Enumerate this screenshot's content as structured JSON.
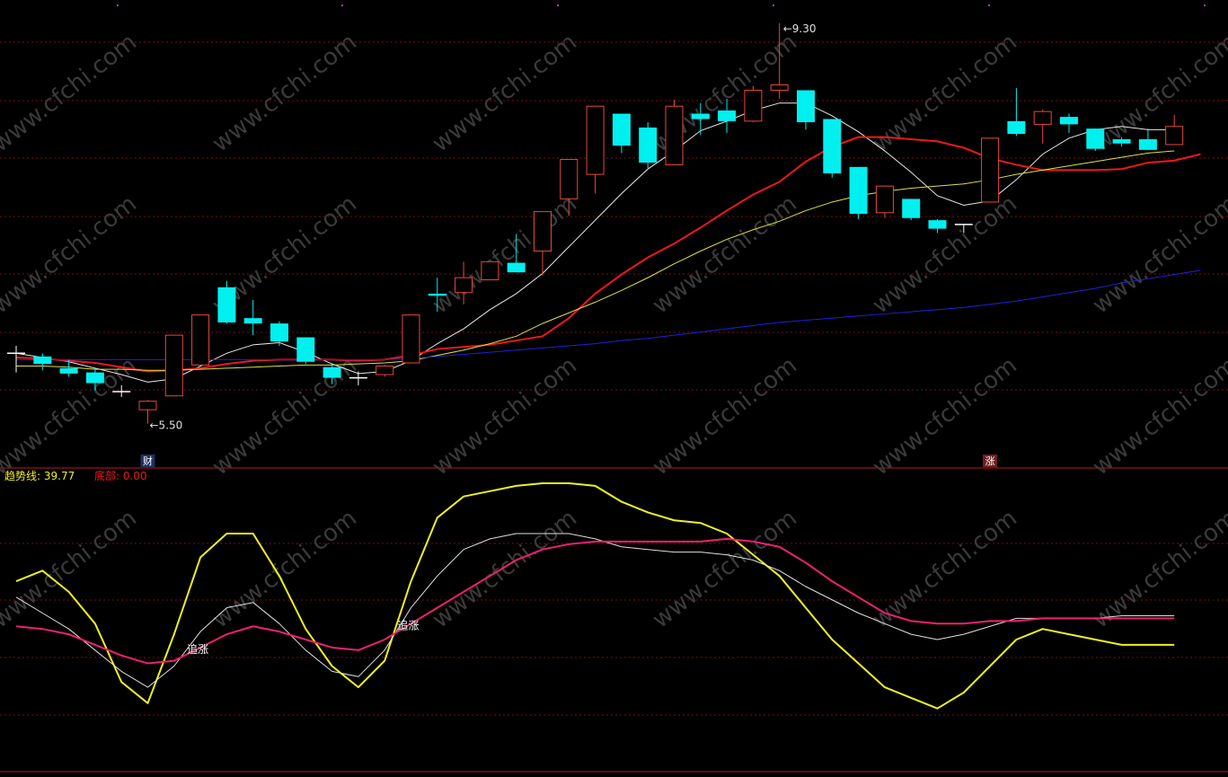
{
  "colors": {
    "background": "#000000",
    "up": "#e8483a",
    "down": "#00f0f0",
    "grid": "#7a1010",
    "separator": "#c01818",
    "ma_white": "#e8e8e8",
    "ma_red": "#f01818",
    "ma_yellow": "#e0e040",
    "ma_blue": "#2020e0",
    "ind_yellow": "#f0f020",
    "ind_white": "#e0e0e0",
    "ind_pink": "#f02070",
    "watermark": "#3a3a3a"
  },
  "watermark_text": "www.cfchi.com",
  "chart_data": [
    {
      "type": "candlestick",
      "ylim": [
        5.3,
        9.45
      ],
      "grid": true,
      "annotations": {
        "high_label": "9.30",
        "low_label": "5.50",
        "high_index": 29,
        "low_index": 5,
        "markers": [
          {
            "index": 5,
            "text": "财"
          },
          {
            "index": 37,
            "text": "涨"
          }
        ]
      },
      "ohlc": [
        {
          "o": 6.2,
          "h": 6.27,
          "l": 6.02,
          "c": 6.2
        },
        {
          "o": 6.17,
          "h": 6.2,
          "l": 6.04,
          "c": 6.1
        },
        {
          "o": 6.06,
          "h": 6.14,
          "l": 5.98,
          "c": 6.01
        },
        {
          "o": 6.02,
          "h": 6.06,
          "l": 5.85,
          "c": 5.92
        },
        {
          "o": 5.83,
          "h": 5.9,
          "l": 5.79,
          "c": 5.84
        },
        {
          "o": 5.67,
          "h": 5.76,
          "l": 5.54,
          "c": 5.75
        },
        {
          "o": 5.8,
          "h": 6.37,
          "l": 5.8,
          "c": 6.37
        },
        {
          "o": 6.09,
          "h": 6.56,
          "l": 6.09,
          "c": 6.56
        },
        {
          "o": 6.82,
          "h": 6.88,
          "l": 6.48,
          "c": 6.49
        },
        {
          "o": 6.53,
          "h": 6.7,
          "l": 6.37,
          "c": 6.48
        },
        {
          "o": 6.48,
          "h": 6.5,
          "l": 6.27,
          "c": 6.31
        },
        {
          "o": 6.35,
          "h": 6.35,
          "l": 6.1,
          "c": 6.12
        },
        {
          "o": 6.07,
          "h": 6.11,
          "l": 5.91,
          "c": 5.97
        },
        {
          "o": 5.97,
          "h": 6.03,
          "l": 5.9,
          "c": 5.97
        },
        {
          "o": 6.0,
          "h": 6.09,
          "l": 5.98,
          "c": 6.08
        },
        {
          "o": 6.11,
          "h": 6.56,
          "l": 6.11,
          "c": 6.56
        },
        {
          "o": 6.76,
          "h": 6.91,
          "l": 6.59,
          "c": 6.74
        },
        {
          "o": 6.77,
          "h": 7.06,
          "l": 6.66,
          "c": 6.91
        },
        {
          "o": 6.89,
          "h": 7.06,
          "l": 6.89,
          "c": 7.06
        },
        {
          "o": 7.05,
          "h": 7.32,
          "l": 6.98,
          "c": 6.96
        },
        {
          "o": 7.16,
          "h": 7.53,
          "l": 6.93,
          "c": 7.53
        },
        {
          "o": 7.65,
          "h": 7.84,
          "l": 7.49,
          "c": 8.02
        },
        {
          "o": 7.88,
          "h": 8.52,
          "l": 7.7,
          "c": 8.52
        },
        {
          "o": 8.45,
          "h": 8.45,
          "l": 8.08,
          "c": 8.15
        },
        {
          "o": 8.32,
          "h": 8.37,
          "l": 7.94,
          "c": 7.99
        },
        {
          "o": 7.97,
          "h": 8.58,
          "l": 7.97,
          "c": 8.52
        },
        {
          "o": 8.45,
          "h": 8.55,
          "l": 8.25,
          "c": 8.4
        },
        {
          "o": 8.48,
          "h": 8.59,
          "l": 8.27,
          "c": 8.38
        },
        {
          "o": 8.38,
          "h": 8.71,
          "l": 8.37,
          "c": 8.67
        },
        {
          "o": 8.67,
          "h": 9.3,
          "l": 8.59,
          "c": 8.72
        },
        {
          "o": 8.67,
          "h": 8.67,
          "l": 8.3,
          "c": 8.37
        },
        {
          "o": 8.4,
          "h": 8.4,
          "l": 7.85,
          "c": 7.89
        },
        {
          "o": 7.95,
          "h": 7.95,
          "l": 7.46,
          "c": 7.51
        },
        {
          "o": 7.52,
          "h": 7.77,
          "l": 7.47,
          "c": 7.77
        },
        {
          "o": 7.65,
          "h": 7.65,
          "l": 7.45,
          "c": 7.47
        },
        {
          "o": 7.45,
          "h": 7.46,
          "l": 7.33,
          "c": 7.37
        },
        {
          "o": 7.41,
          "h": 7.41,
          "l": 7.33,
          "c": 7.41
        },
        {
          "o": 7.62,
          "h": 8.22,
          "l": 7.62,
          "c": 8.22
        },
        {
          "o": 8.38,
          "h": 8.69,
          "l": 8.24,
          "c": 8.26
        },
        {
          "o": 8.35,
          "h": 8.49,
          "l": 8.17,
          "c": 8.47
        },
        {
          "o": 8.42,
          "h": 8.45,
          "l": 8.27,
          "c": 8.35
        },
        {
          "o": 8.31,
          "h": 8.31,
          "l": 8.1,
          "c": 8.12
        },
        {
          "o": 8.21,
          "h": 8.23,
          "l": 8.14,
          "c": 8.17
        },
        {
          "o": 8.21,
          "h": 8.31,
          "l": 8.11,
          "c": 8.11
        },
        {
          "o": 8.16,
          "h": 8.44,
          "l": 8.16,
          "c": 8.33
        }
      ],
      "series": [
        {
          "color_key": "ma_white",
          "width": 1,
          "values": [
            6.2,
            6.16,
            6.12,
            6.06,
            6.0,
            5.93,
            5.96,
            6.08,
            6.2,
            6.28,
            6.3,
            6.21,
            6.1,
            6.01,
            6.03,
            6.13,
            6.29,
            6.43,
            6.61,
            6.76,
            6.95,
            7.2,
            7.45,
            7.7,
            7.93,
            8.1,
            8.29,
            8.38,
            8.48,
            8.55,
            8.55,
            8.43,
            8.28,
            8.1,
            7.9,
            7.68,
            7.59,
            7.63,
            7.83,
            8.07,
            8.22,
            8.3,
            8.33,
            8.3,
            8.3
          ]
        },
        {
          "color_key": "ma_red",
          "width": 2,
          "values": [
            6.16,
            6.15,
            6.13,
            6.11,
            6.07,
            6.03,
            6.04,
            6.06,
            6.1,
            6.13,
            6.14,
            6.14,
            6.14,
            6.13,
            6.14,
            6.18,
            6.24,
            6.26,
            6.28,
            6.32,
            6.36,
            6.53,
            6.76,
            6.94,
            7.1,
            7.23,
            7.38,
            7.54,
            7.69,
            7.81,
            8.0,
            8.14,
            8.23,
            8.23,
            8.21,
            8.19,
            8.13,
            8.03,
            7.97,
            7.92,
            7.92,
            7.92,
            7.93,
            7.99,
            8.01,
            8.07
          ]
        },
        {
          "color_key": "ma_yellow",
          "width": 1,
          "values": [
            6.08,
            6.08,
            6.07,
            6.05,
            6.05,
            6.04,
            6.04,
            6.05,
            6.06,
            6.07,
            6.08,
            6.09,
            6.09,
            6.1,
            6.11,
            6.13,
            6.18,
            6.23,
            6.29,
            6.36,
            6.48,
            6.58,
            6.68,
            6.79,
            6.91,
            7.04,
            7.16,
            7.27,
            7.36,
            7.44,
            7.54,
            7.62,
            7.68,
            7.72,
            7.75,
            7.77,
            7.79,
            7.83,
            7.88,
            7.92,
            7.96,
            8.0,
            8.04,
            8.08,
            8.1
          ]
        },
        {
          "color_key": "ma_blue",
          "width": 1,
          "values": [
            6.14,
            6.14,
            6.14,
            6.14,
            6.14,
            6.14,
            6.14,
            6.14,
            6.14,
            6.14,
            6.14,
            6.14,
            6.14,
            6.14,
            6.14,
            6.15,
            6.17,
            6.19,
            6.21,
            6.23,
            6.25,
            6.27,
            6.29,
            6.32,
            6.34,
            6.37,
            6.4,
            6.43,
            6.46,
            6.49,
            6.51,
            6.53,
            6.55,
            6.57,
            6.59,
            6.61,
            6.63,
            6.66,
            6.69,
            6.73,
            6.77,
            6.81,
            6.86,
            6.9,
            6.94,
            6.98
          ]
        }
      ]
    },
    {
      "type": "line",
      "legend": [
        {
          "text": "趋势线: 39.77",
          "color_key": "ind_yellow"
        },
        {
          "text": "底部: 0.00",
          "color_key": "ma_red"
        }
      ],
      "ylim": [
        0,
        100
      ],
      "grid": true,
      "annotations": [
        {
          "index": 7,
          "text": "追涨"
        },
        {
          "index": 15,
          "text": "追涨"
        }
      ],
      "series": [
        {
          "color_key": "ind_yellow",
          "width": 2,
          "values": [
            62,
            66,
            58,
            46,
            24,
            16,
            42,
            71,
            80,
            80,
            64,
            44,
            30,
            22,
            32,
            62,
            86,
            94,
            96,
            98,
            99,
            99,
            98,
            92,
            88,
            85,
            84,
            80,
            72,
            64,
            52,
            40,
            31,
            22,
            18,
            14,
            20,
            30,
            40,
            44,
            42,
            40,
            38,
            38,
            38
          ]
        },
        {
          "color_key": "ind_white",
          "width": 1,
          "values": [
            56,
            50,
            44,
            36,
            28,
            22,
            30,
            43,
            52,
            54,
            46,
            36,
            28,
            26,
            36,
            52,
            64,
            74,
            78,
            80,
            80,
            80,
            78,
            75,
            74,
            73,
            73,
            72,
            70,
            66,
            60,
            55,
            50,
            46,
            42,
            40,
            42,
            45,
            48,
            48,
            48,
            48,
            49,
            49,
            49
          ]
        },
        {
          "color_key": "ind_pink",
          "width": 2,
          "values": [
            45,
            44,
            42,
            38,
            34,
            31,
            32,
            37,
            42,
            45,
            43,
            40,
            37,
            36,
            40,
            46,
            52,
            58,
            64,
            70,
            74,
            76,
            77,
            77,
            77,
            77,
            77,
            78,
            77,
            75,
            69,
            62,
            56,
            50,
            47,
            46,
            46,
            47,
            47,
            48,
            48,
            48,
            48,
            48,
            48
          ]
        }
      ]
    }
  ]
}
